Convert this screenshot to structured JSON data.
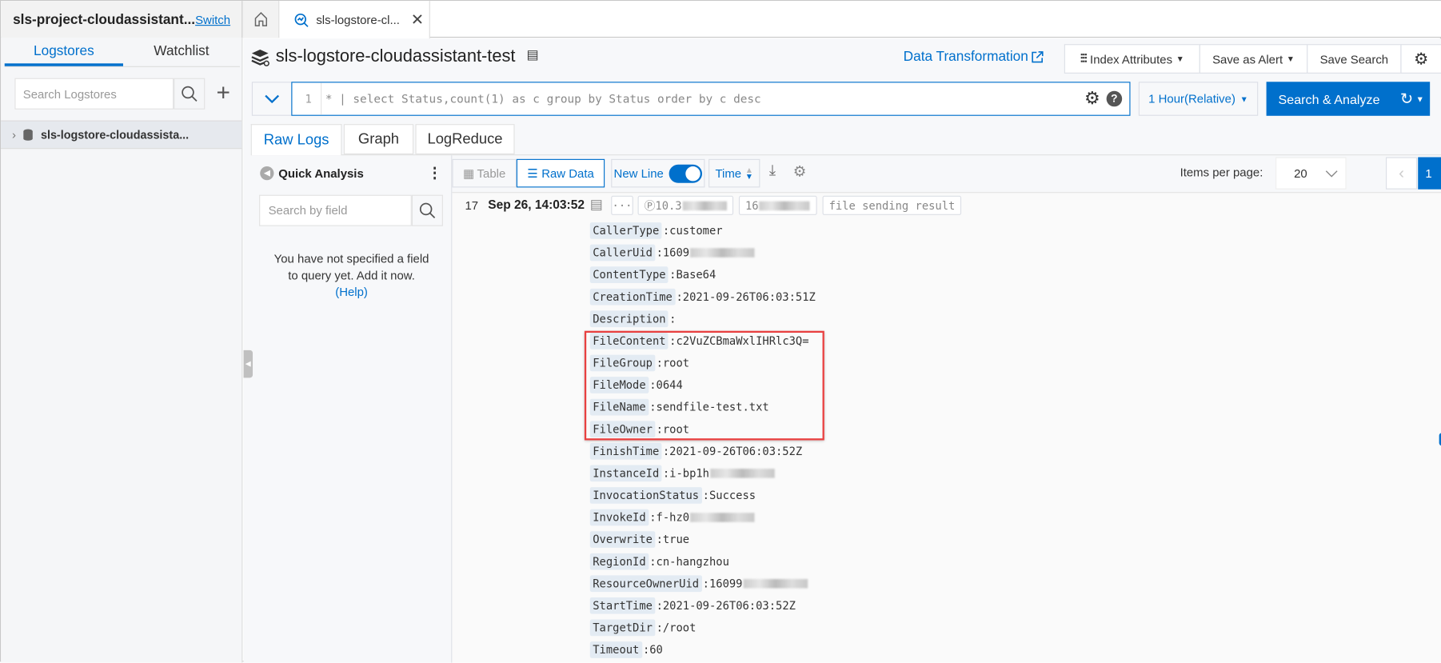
{
  "header": {
    "project": "sls-project-cloudassistant...",
    "switch_label": "Switch",
    "tab_label": "sls-logstore-cl..."
  },
  "sidebar": {
    "tabs": [
      "Logstores",
      "Watchlist"
    ],
    "search_placeholder": "Search Logstores",
    "items": [
      {
        "label": "sls-logstore-cloudassista..."
      }
    ]
  },
  "main": {
    "title": "sls-logstore-cloudassistant-test",
    "data_transformation": "Data Transformation",
    "toolbar": {
      "index_attributes": "Index Attributes",
      "save_as_alert": "Save as Alert",
      "save_search": "Save Search"
    },
    "query": {
      "line_number": "1",
      "text": "* | select Status,count(1) as c group by Status order by c desc",
      "time_range": "1 Hour(Relative)",
      "search_button": "Search & Analyze"
    },
    "tabs": [
      "Raw Logs",
      "Graph",
      "LogReduce"
    ],
    "quick_analysis": {
      "title": "Quick Analysis",
      "search_placeholder": "Search by field",
      "empty_line1": "You have not specified a field",
      "empty_line2": "to query yet. Add it now.",
      "help": "(Help)"
    },
    "view": {
      "table": "Table",
      "raw_data": "Raw Data",
      "new_line": "New Line",
      "new_line_on": true,
      "time_sort": "Time",
      "items_per_page_label": "Items per page:",
      "items_per_page": "20",
      "current_page": "1"
    },
    "log": {
      "index": "17",
      "time": "Sep 26, 14:03:52",
      "chip_ip": "10.3",
      "chip_id": "16",
      "chip_topic": "file sending result",
      "fields": [
        {
          "key": "CallerType",
          "value": ":customer"
        },
        {
          "key": "CallerUid",
          "value": ":1609",
          "redacted": true
        },
        {
          "key": "ContentType",
          "value": ":Base64"
        },
        {
          "key": "CreationTime",
          "value": ":2021-09-26T06:03:51Z"
        },
        {
          "key": "Description",
          "value": ":"
        },
        {
          "key": "FileContent",
          "value": ":c2VuZCBmaWxlIHRlc3Q="
        },
        {
          "key": "FileGroup",
          "value": ":root"
        },
        {
          "key": "FileMode",
          "value": ":0644"
        },
        {
          "key": "FileName",
          "value": ":sendfile-test.txt"
        },
        {
          "key": "FileOwner",
          "value": ":root"
        },
        {
          "key": "FinishTime",
          "value": ":2021-09-26T06:03:52Z"
        },
        {
          "key": "InstanceId",
          "value": ":i-bp1h",
          "redacted": true
        },
        {
          "key": "InvocationStatus",
          "value": ":Success"
        },
        {
          "key": "InvokeId",
          "value": ":f-hz0",
          "redacted": true
        },
        {
          "key": "Overwrite",
          "value": ":true"
        },
        {
          "key": "RegionId",
          "value": ":cn-hangzhou"
        },
        {
          "key": "ResourceOwnerUid",
          "value": ":16099",
          "redacted": true
        },
        {
          "key": "StartTime",
          "value": ":2021-09-26T06:03:52Z"
        },
        {
          "key": "TargetDir",
          "value": ":/root"
        },
        {
          "key": "Timeout",
          "value": ":60"
        }
      ]
    }
  },
  "colors": {
    "accent": "#0070cc",
    "highlight_box": "#e84040"
  }
}
